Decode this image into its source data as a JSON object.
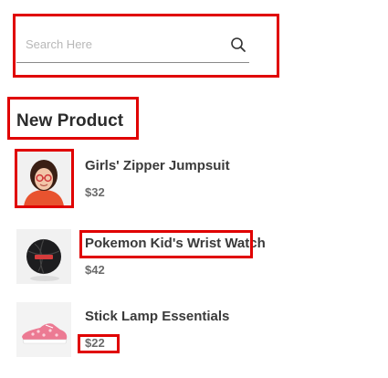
{
  "search": {
    "placeholder": "Search Here",
    "icon": "search-icon"
  },
  "new_product": {
    "title": "New Product",
    "items": [
      {
        "name": "Girls' Zipper Jumpsuit",
        "price": "$32",
        "image": "girl-with-glasses-photo"
      },
      {
        "name": "Pokemon Kid's Wrist Watch",
        "price": "$42",
        "image": "basketball-photo"
      },
      {
        "name": "Stick Lamp Essentials",
        "price": "$22",
        "image": "pink-sneaker-photo"
      }
    ]
  },
  "colors": {
    "highlight": "#e00000",
    "title_text": "#2b2b2b",
    "price_text": "#6b6b6b",
    "thumb_bg": "#f3f3f3"
  }
}
